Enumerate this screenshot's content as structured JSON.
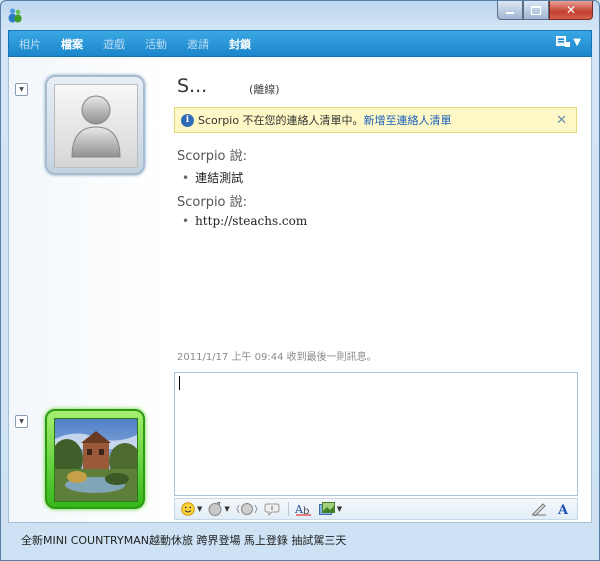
{
  "menu": {
    "items": [
      {
        "label": "相片",
        "active": false
      },
      {
        "label": "檔案",
        "active": true
      },
      {
        "label": "遊戲",
        "active": false
      },
      {
        "label": "活動",
        "active": false
      },
      {
        "label": "邀請",
        "active": false
      },
      {
        "label": "封鎖",
        "active": true
      }
    ]
  },
  "contact": {
    "name": "S...",
    "status": "(離線)"
  },
  "infobar": {
    "message": "Scorpio 不在您的連絡人清單中。",
    "link": "新增至連絡人清單",
    "close": "✕"
  },
  "messages": [
    {
      "sender": "Scorpio 說:",
      "text": "連結測試",
      "bullet": "•"
    },
    {
      "sender": "Scorpio 說:",
      "text": "http://steachs.com",
      "bullet": "•"
    }
  ],
  "timestamp": "2011/1/17 上午 09:44 收到最後一則訊息。",
  "footer_ad": "全新MINI COUNTRYMAN越動休旅 跨界登場 馬上登錄 抽試駕三天",
  "colors": {
    "menubar": "#1b86cc",
    "link": "#1a5fbd",
    "infobar_bg": "#fdf8c6",
    "my_frame": "#34b81a"
  },
  "icons": {
    "emoticon": "smiley-icon",
    "wink": "wink-icon",
    "nudge": "nudge-icon",
    "voice_clip": "voice-clip-icon",
    "font": "font-icon",
    "background": "background-icon",
    "handwriting": "handwriting-icon",
    "text_format": "text-format-icon"
  }
}
